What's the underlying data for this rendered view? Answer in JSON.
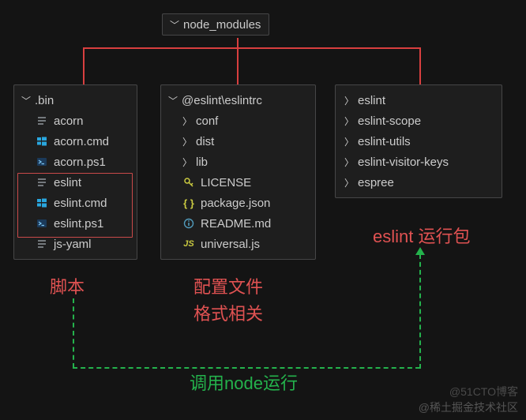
{
  "root": {
    "label": "node_modules"
  },
  "bin": {
    "label": ".bin",
    "items": [
      {
        "name": "acorn",
        "icon": "file-lines"
      },
      {
        "name": "acorn.cmd",
        "icon": "win"
      },
      {
        "name": "acorn.ps1",
        "icon": "ps"
      },
      {
        "name": "eslint",
        "icon": "file-lines"
      },
      {
        "name": "eslint.cmd",
        "icon": "win"
      },
      {
        "name": "eslint.ps1",
        "icon": "ps"
      },
      {
        "name": "js-yaml",
        "icon": "file-lines"
      }
    ]
  },
  "eslintrc": {
    "label": "@eslint\\eslintrc",
    "items": [
      {
        "name": "conf",
        "icon": "folder"
      },
      {
        "name": "dist",
        "icon": "folder"
      },
      {
        "name": "lib",
        "icon": "folder"
      },
      {
        "name": "LICENSE",
        "icon": "key"
      },
      {
        "name": "package.json",
        "icon": "json"
      },
      {
        "name": "README.md",
        "icon": "info"
      },
      {
        "name": "universal.js",
        "icon": "js"
      }
    ]
  },
  "pkg": {
    "items": [
      {
        "name": "eslint"
      },
      {
        "name": "eslint-scope"
      },
      {
        "name": "eslint-utils"
      },
      {
        "name": "eslint-visitor-keys"
      },
      {
        "name": "espree"
      }
    ]
  },
  "captions": {
    "script": "脚本",
    "config1": "配置文件",
    "config2": "格式相关",
    "runpkg": "eslint 运行包",
    "invoke": "调用node运行"
  },
  "watermark1": "@稀土掘金技术社区",
  "watermark2": "@51CTO博客"
}
